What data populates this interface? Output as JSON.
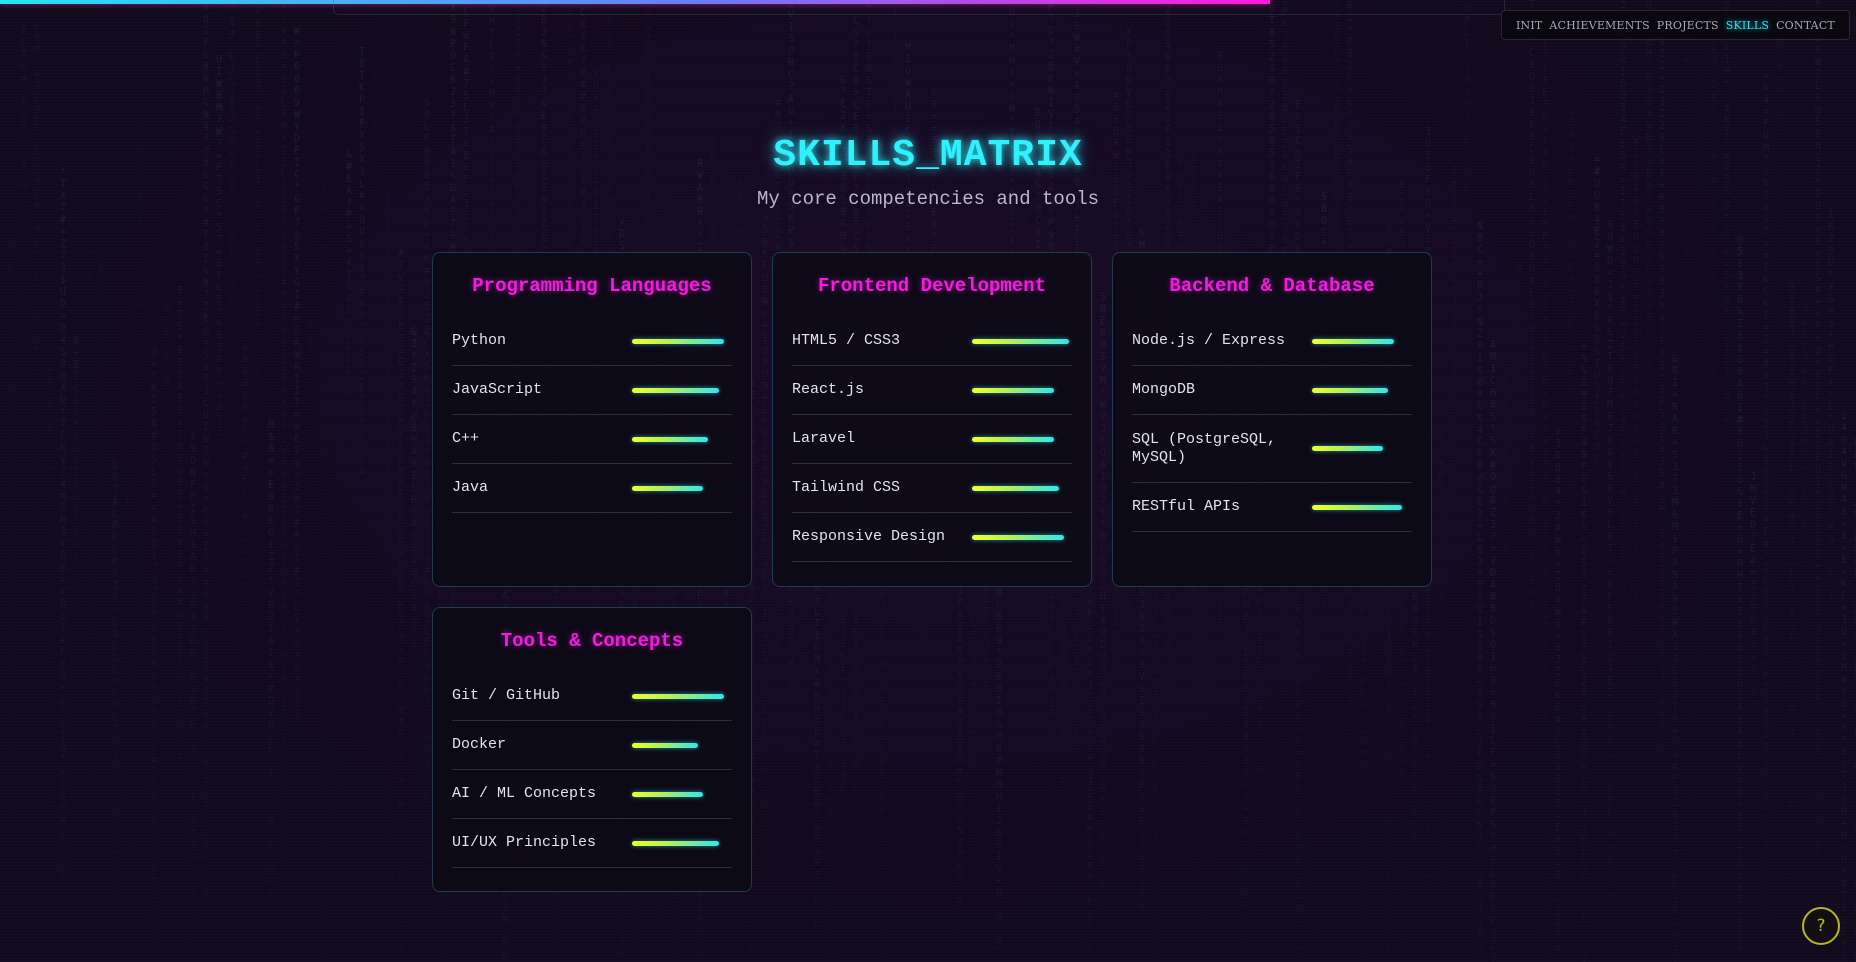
{
  "progress": {
    "scrolled": 0.684
  },
  "nav": {
    "items": [
      {
        "label": "INIT",
        "active": false
      },
      {
        "label": "ACHIEVEMENTS",
        "active": false
      },
      {
        "label": "PROJECTS",
        "active": false
      },
      {
        "label": "SKILLS",
        "active": true
      },
      {
        "label": "CONTACT",
        "active": false
      }
    ]
  },
  "section": {
    "title": "SKILLS_MATRIX",
    "subtitle": "My core competencies and tools"
  },
  "categories": [
    {
      "title": "Programming Languages",
      "skills": [
        {
          "name": "Python",
          "level": 0.92
        },
        {
          "name": "JavaScript",
          "level": 0.87
        },
        {
          "name": "C++",
          "level": 0.76
        },
        {
          "name": "Java",
          "level": 0.71
        }
      ]
    },
    {
      "title": "Frontend Development",
      "skills": [
        {
          "name": "HTML5 / CSS3",
          "level": 0.97
        },
        {
          "name": "React.js",
          "level": 0.82
        },
        {
          "name": "Laravel",
          "level": 0.82
        },
        {
          "name": "Tailwind CSS",
          "level": 0.87
        },
        {
          "name": "Responsive Design",
          "level": 0.92
        }
      ]
    },
    {
      "title": "Backend & Database",
      "skills": [
        {
          "name": "Node.js / Express",
          "level": 0.82
        },
        {
          "name": "MongoDB",
          "level": 0.76
        },
        {
          "name": "SQL (PostgreSQL, MySQL)",
          "level": 0.71
        },
        {
          "name": "RESTful APIs",
          "level": 0.9
        }
      ]
    },
    {
      "title": "Tools & Concepts",
      "skills": [
        {
          "name": "Git / GitHub",
          "level": 0.92
        },
        {
          "name": "Docker",
          "level": 0.66
        },
        {
          "name": "AI / ML Concepts",
          "level": 0.71
        },
        {
          "name": "UI/UX Principles",
          "level": 0.87
        }
      ]
    }
  ],
  "help": {
    "label": "?"
  },
  "colors": {
    "accent_cyan": "#2ef1fb",
    "accent_magenta": "#f21be0",
    "bar_start": "#f2ff2a",
    "bar_end": "#2fe6ee",
    "help_yellow": "#b4b71d",
    "background": "#120a1d"
  }
}
